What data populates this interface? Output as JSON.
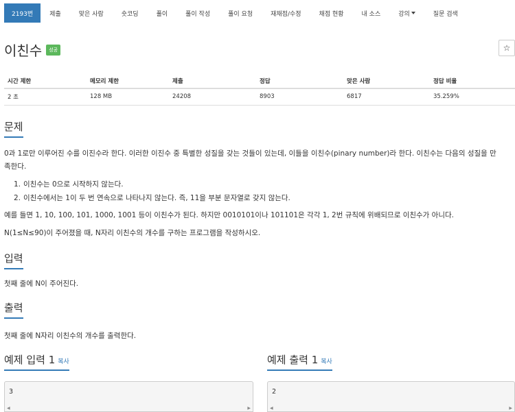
{
  "nav": {
    "tabs": [
      "2193번",
      "제출",
      "맞은 사람",
      "숏코딩",
      "풀이",
      "풀이 작성",
      "풀이 요청",
      "재채점/수정",
      "채점 현황",
      "내 소스",
      "강의",
      "질문 검색"
    ]
  },
  "problem": {
    "title": "이친수",
    "badge": "성공",
    "star": "☆"
  },
  "info": {
    "headers": [
      "시간 제한",
      "메모리 제한",
      "제출",
      "정답",
      "맞은 사람",
      "정답 비율"
    ],
    "values": [
      "2 초",
      "128 MB",
      "24208",
      "8903",
      "6817",
      "35.259%"
    ]
  },
  "sections": {
    "problem_head": "문제",
    "problem_p1_line1": "0과 1로만 이루어진 수를 이진수라 한다. 이러한 이진수 중 특별한 성질을 갖는 것들이 있는데, 이들을 이친수(pinary number)라 한다. 이친수는 다음의 성질을 만",
    "problem_p1_line2": "족한다.",
    "rules": [
      {
        "num": "1.",
        "text": "이친수는 0으로 시작하지 않는다."
      },
      {
        "num": "2.",
        "text": "이친수에서는 1이 두 번 연속으로 나타나지 않는다. 즉, 11을 부분 문자열로 갖지 않는다."
      }
    ],
    "problem_p2": "예를 들면 1, 10, 100, 101, 1000, 1001 등이 이친수가 된다. 하지만 0010101이나 101101은 각각 1, 2번 규칙에 위배되므로 이친수가 아니다.",
    "problem_p3": "N(1≤N≤90)이 주어졌을 때, N자리 이친수의 개수를 구하는 프로그램을 작성하시오.",
    "input_head": "입력",
    "input_text": "첫째 줄에 N이 주어진다.",
    "output_head": "출력",
    "output_text": "첫째 줄에 N자리 이친수의 개수를 출력한다.",
    "sample_input_head": "예제 입력 1",
    "sample_output_head": "예제 출력 1",
    "copy_label": "복사",
    "sample_input_value": "3",
    "sample_output_value": "2"
  }
}
